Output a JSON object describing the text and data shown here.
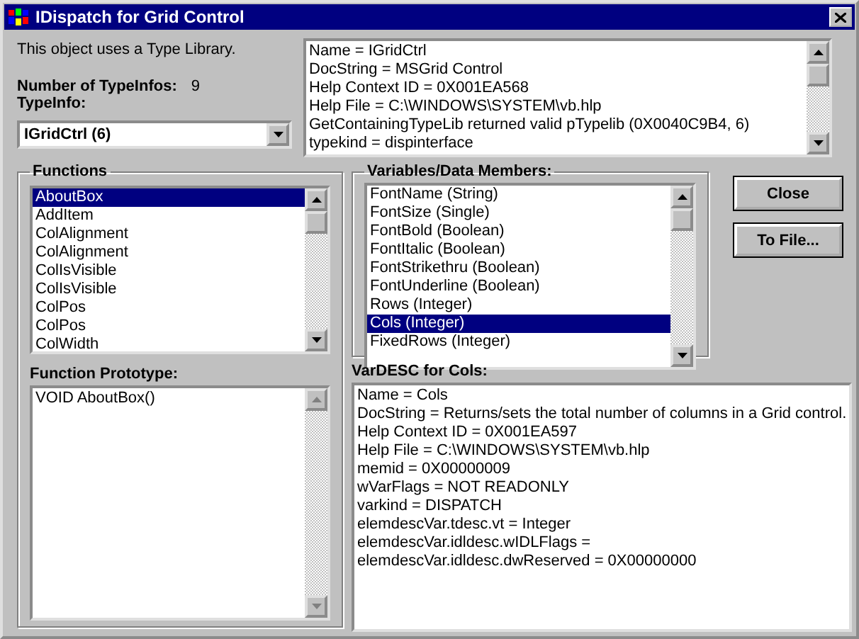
{
  "window": {
    "title": "IDispatch for Grid Control"
  },
  "summary": {
    "note": "This object uses a Type Library.",
    "count_label": "Number of TypeInfos:",
    "count_value": "9",
    "typeinfo_label": "TypeInfo:",
    "typeinfo_value": "IGridCtrl (6)"
  },
  "info_lines": [
    "Name = IGridCtrl",
    "DocString = MSGrid Control",
    "Help Context ID = 0X001EA568",
    "Help File = C:\\WINDOWS\\SYSTEM\\vb.hlp",
    "GetContainingTypeLib returned valid pTypelib (0X0040C9B4, 6)",
    "typekind = dispinterface"
  ],
  "functions": {
    "label": "Functions",
    "items": [
      {
        "label": "AboutBox",
        "selected": true
      },
      {
        "label": "AddItem",
        "selected": false
      },
      {
        "label": "ColAlignment",
        "selected": false
      },
      {
        "label": "ColAlignment",
        "selected": false
      },
      {
        "label": "ColIsVisible",
        "selected": false
      },
      {
        "label": "ColIsVisible",
        "selected": false
      },
      {
        "label": "ColPos",
        "selected": false
      },
      {
        "label": "ColPos",
        "selected": false
      },
      {
        "label": "ColWidth",
        "selected": false
      }
    ],
    "prototype_label": "Function Prototype:",
    "prototype_lines": [
      "VOID AboutBox()"
    ]
  },
  "variables": {
    "label": "Variables/Data Members:",
    "items": [
      {
        "label": "FontName (String)",
        "selected": false
      },
      {
        "label": "FontSize (Single)",
        "selected": false
      },
      {
        "label": "FontBold (Boolean)",
        "selected": false
      },
      {
        "label": "FontItalic (Boolean)",
        "selected": false
      },
      {
        "label": "FontStrikethru (Boolean)",
        "selected": false
      },
      {
        "label": "FontUnderline (Boolean)",
        "selected": false
      },
      {
        "label": "Rows (Integer)",
        "selected": false
      },
      {
        "label": "Cols (Integer)",
        "selected": true
      },
      {
        "label": "FixedRows (Integer)",
        "selected": false
      }
    ]
  },
  "buttons": [
    "Close",
    "To File..."
  ],
  "vardesc": {
    "label": "VarDESC for Cols:",
    "lines": [
      "Name = Cols",
      "DocString = Returns/sets the total number of columns in a Grid control.",
      "Help Context ID = 0X001EA597",
      "Help File = C:\\WINDOWS\\SYSTEM\\vb.hlp",
      "memid = 0X00000009",
      "wVarFlags = NOT READONLY",
      "varkind = DISPATCH",
      "elemdescVar.tdesc.vt = Integer",
      "elemdescVar.idldesc.wIDLFlags =",
      "elemdescVar.idldesc.dwReserved = 0X00000000"
    ]
  }
}
